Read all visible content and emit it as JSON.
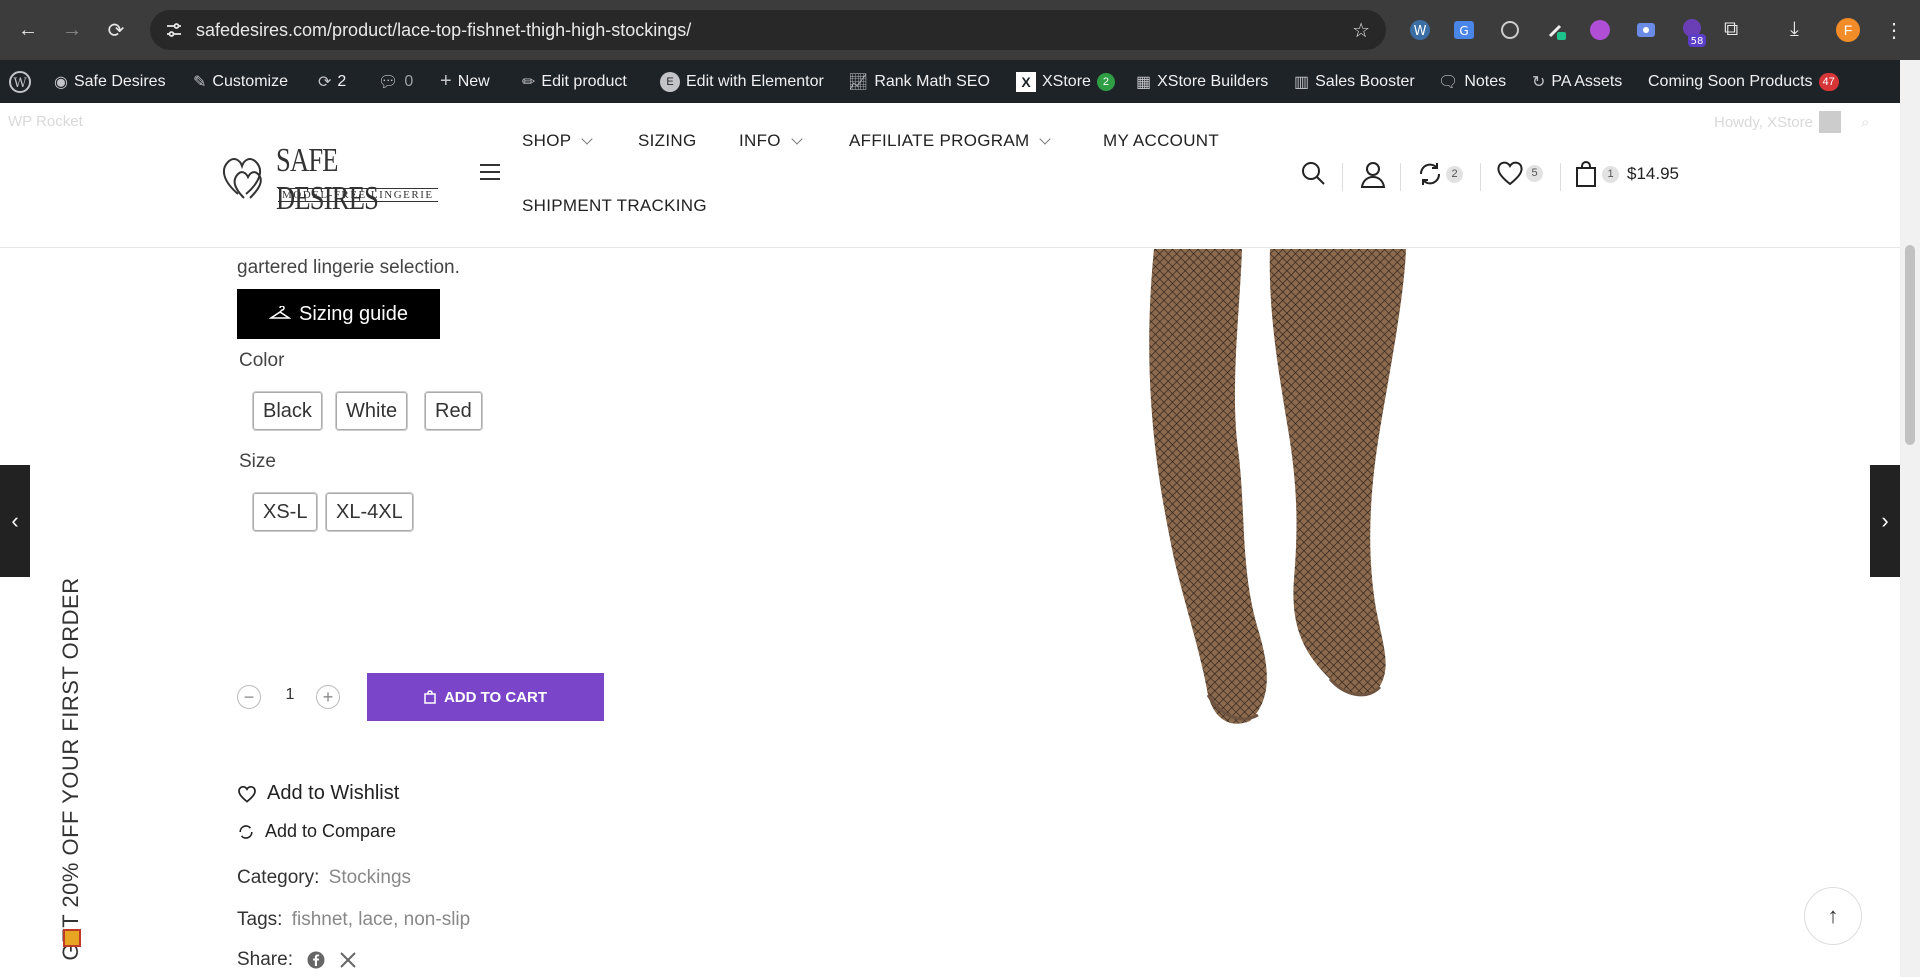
{
  "browser": {
    "url": "safedesires.com/product/lace-top-fishnet-thigh-high-stockings/",
    "ext_badge": "58",
    "profile_initial": "F"
  },
  "admin_bar": {
    "site_name": "Safe Desires",
    "customize": "Customize",
    "updates_count": "2",
    "comments_count": "0",
    "new": "New",
    "edit_product": "Edit product",
    "edit_elementor": "Edit with Elementor",
    "rank_math": "Rank Math SEO",
    "xstore": "XStore",
    "xstore_badge": "2",
    "xstore_builders": "XStore Builders",
    "sales_booster": "Sales Booster",
    "notes": "Notes",
    "pa_assets": "PA Assets",
    "coming_soon": "Coming Soon Products",
    "coming_soon_badge": "47",
    "wp_rocket": "WP Rocket",
    "howdy": "Howdy, XStore"
  },
  "header": {
    "logo_text": "SAFE DESIRES",
    "logo_tagline": "MODEL-FREE LINGERIE",
    "nav": {
      "shop": "SHOP",
      "sizing": "SIZING",
      "info": "INFO",
      "affiliate": "AFFILIATE PROGRAM",
      "account": "MY ACCOUNT",
      "tracking": "SHIPMENT TRACKING"
    },
    "compare_count": "2",
    "wishlist_count": "5",
    "cart_count": "1",
    "cart_total": "$14.95"
  },
  "product": {
    "desc_tail": "gartered lingerie selection.",
    "sizing_guide": "Sizing guide",
    "color_label": "Color",
    "colors": [
      "Black",
      "White",
      "Red"
    ],
    "size_label": "Size",
    "sizes": [
      "XS-L",
      "XL-4XL"
    ],
    "qty": "1",
    "add_to_cart": "ADD TO CART",
    "add_wishlist": "Add to Wishlist",
    "add_compare": "Add to Compare",
    "category_label": "Category:",
    "category": "Stockings",
    "tags_label": "Tags:",
    "tags": [
      "fishnet",
      "lace",
      "non-slip"
    ],
    "share_label": "Share:"
  },
  "promo": {
    "side_text": "GET 20% OFF YOUR FIRST ORDER"
  }
}
